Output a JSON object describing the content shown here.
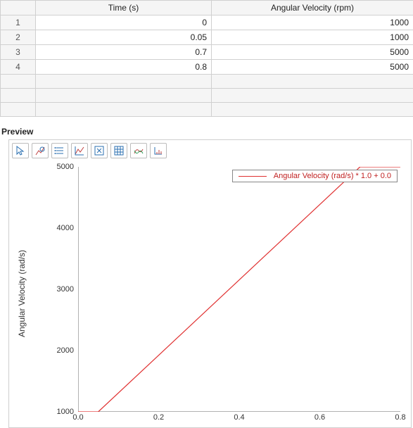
{
  "table": {
    "columns": [
      "Time (s)",
      "Angular Velocity (rpm)"
    ],
    "rows": [
      {
        "n": "1",
        "time": "0",
        "av": "1000"
      },
      {
        "n": "2",
        "time": "0.05",
        "av": "1000"
      },
      {
        "n": "3",
        "time": "0.7",
        "av": "5000"
      },
      {
        "n": "4",
        "time": "0.8",
        "av": "5000"
      }
    ],
    "blank_rows": 3
  },
  "preview": {
    "title": "Preview"
  },
  "toolbar": {
    "items": [
      {
        "name": "pointer-icon"
      },
      {
        "name": "zoom-mode-icon"
      },
      {
        "name": "list-icon"
      },
      {
        "name": "line-plot-icon"
      },
      {
        "name": "zoom-fit-icon"
      },
      {
        "name": "grid-icon"
      },
      {
        "name": "multi-line-icon"
      },
      {
        "name": "axes-config-icon"
      }
    ]
  },
  "chart_data": {
    "type": "line",
    "title": "",
    "xlabel": "",
    "ylabel": "Angular Velocity (rad/s)",
    "xlim": [
      0.0,
      0.8
    ],
    "ylim": [
      1000,
      5000
    ],
    "xticks": [
      0.0,
      0.2,
      0.4,
      0.6,
      0.8
    ],
    "yticks": [
      1000,
      2000,
      3000,
      4000,
      5000
    ],
    "series": [
      {
        "name": "Angular Velocity (rad/s) * 1.0 + 0.0",
        "x": [
          0,
          0.05,
          0.7,
          0.8
        ],
        "y": [
          1000,
          1000,
          5000,
          5000
        ]
      }
    ]
  }
}
